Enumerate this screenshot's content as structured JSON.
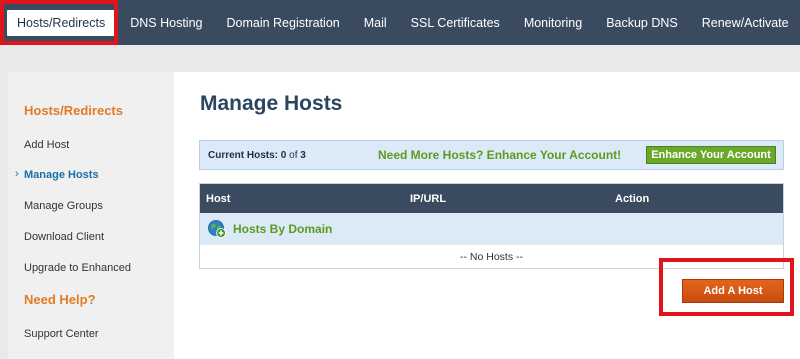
{
  "topnav": {
    "items": [
      {
        "label": "Hosts/Redirects",
        "active": true
      },
      {
        "label": "DNS Hosting"
      },
      {
        "label": "Domain Registration"
      },
      {
        "label": "Mail"
      },
      {
        "label": "SSL Certificates"
      },
      {
        "label": "Monitoring"
      },
      {
        "label": "Backup DNS"
      },
      {
        "label": "Renew/Activate"
      }
    ]
  },
  "sidebar": {
    "heading": "Hosts/Redirects",
    "items": [
      {
        "label": "Add Host"
      },
      {
        "label": "Manage Hosts",
        "active": true
      },
      {
        "label": "Manage Groups"
      },
      {
        "label": "Download Client"
      },
      {
        "label": "Upgrade to Enhanced"
      }
    ],
    "help_heading": "Need Help?",
    "help_items": [
      {
        "label": "Support Center"
      }
    ],
    "active_chevron": "›"
  },
  "main": {
    "title": "Manage Hosts",
    "info": {
      "current_label": "Current Hosts:",
      "current_count": "0",
      "of_text": "of",
      "max_count": "3",
      "promo_text": "Need More Hosts? Enhance Your Account!",
      "enhance_button": "Enhance Your Account"
    },
    "table": {
      "columns": [
        "Host",
        "IP/URL",
        "Action"
      ],
      "group_label": "Hosts By Domain",
      "group_icon": "globe-add-icon",
      "empty_text": "-- No Hosts --"
    },
    "add_button": "Add A Host"
  },
  "colors": {
    "nav_bg": "#3a4a5f",
    "accent_orange": "#e07b28",
    "accent_green": "#5b9c1e",
    "highlight_red": "#e0141b"
  }
}
